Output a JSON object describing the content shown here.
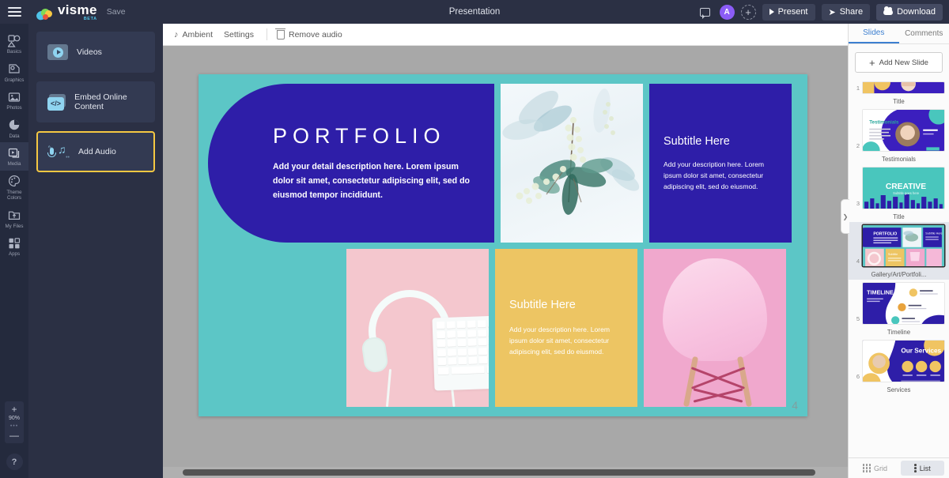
{
  "header": {
    "menu_icon": "hamburger-icon",
    "logo_text": "visme",
    "logo_beta": "BETA",
    "save_label": "Save",
    "doc_title": "Presentation",
    "chat_icon": "chat-icon",
    "avatar_initial": "A",
    "add_user_icon": "add-user-icon",
    "present_label": "Present",
    "share_label": "Share",
    "download_label": "Download"
  },
  "rail": {
    "items": [
      {
        "label": "Basics",
        "icon": "basics-icon",
        "active": false
      },
      {
        "label": "Graphics",
        "icon": "graphics-icon",
        "active": false
      },
      {
        "label": "Photos",
        "icon": "photos-icon",
        "active": false
      },
      {
        "label": "Data",
        "icon": "data-icon",
        "active": false
      },
      {
        "label": "Media",
        "icon": "media-icon",
        "active": true
      },
      {
        "label": "Theme Colors",
        "icon": "theme-colors-icon",
        "active": false
      },
      {
        "label": "My Files",
        "icon": "my-files-icon",
        "active": false
      },
      {
        "label": "Apps",
        "icon": "apps-icon",
        "active": false
      }
    ],
    "zoom_in": "+",
    "zoom_value": "90%",
    "zoom_out": "—",
    "help_label": "?"
  },
  "media_panel": {
    "cards": [
      {
        "label": "Videos",
        "icon": "video-icon",
        "selected": false
      },
      {
        "label": "Embed Online Content",
        "icon": "embed-code-icon",
        "selected": false
      },
      {
        "label": "Add Audio",
        "icon": "audio-icon",
        "selected": true
      }
    ]
  },
  "toolbar": {
    "audio_track": "Ambient",
    "settings_label": "Settings",
    "remove_audio_label": "Remove audio",
    "note_icon": "music-note-icon",
    "trash_icon": "trash-icon"
  },
  "slide": {
    "number": "4",
    "background_color": "#5cc6c6",
    "blocks": {
      "portfolio": {
        "title": "PORTFOLIO",
        "body": "Add your detail description here. Lorem ipsum dolor sit amet, consectetur adipiscing elit, sed do eiusmod tempor incididunt.",
        "color": "#2e1ea8"
      },
      "botanical": {
        "alt": "watercolor botanical leaves illustration"
      },
      "subtitle_right": {
        "title": "Subtitle Here",
        "body": "Add your description here. Lorem ipsum dolor sit amet, consectetur adipiscing elit, sed do eiusmod.",
        "color": "#2e1ea8"
      },
      "headphones": {
        "alt": "white headphones and keyboard on pink background"
      },
      "subtitle_yellow": {
        "title": "Subtitle Here",
        "body": "Add your description here. Lorem ipsum dolor sit amet, consectetur adipiscing elit, sed do eiusmod.",
        "color": "#edc563"
      },
      "chair": {
        "alt": "pink chair on pink background"
      }
    }
  },
  "right_panel": {
    "tabs": [
      {
        "label": "Slides",
        "active": true
      },
      {
        "label": "Comments",
        "active": false
      }
    ],
    "add_new_slide": "Add New Slide",
    "collapse_icon": "chevron-right-icon",
    "slides": [
      {
        "num": "1",
        "caption": "Title",
        "active": false,
        "theme": "title"
      },
      {
        "num": "2",
        "caption": "Testimonials",
        "active": false,
        "theme": "testimonials"
      },
      {
        "num": "3",
        "caption": "Title",
        "active": false,
        "theme": "creative"
      },
      {
        "num": "4",
        "caption": "Gallery/Art/Portfoli...",
        "active": true,
        "theme": "gallery"
      },
      {
        "num": "5",
        "caption": "Timeline",
        "active": false,
        "theme": "timeline"
      },
      {
        "num": "6",
        "caption": "Services",
        "active": false,
        "theme": "services"
      }
    ],
    "view_modes": [
      {
        "label": "Grid",
        "active": false,
        "icon": "grid-icon"
      },
      {
        "label": "List",
        "active": true,
        "icon": "list-icon"
      }
    ]
  },
  "thumbnails": {
    "slide3_title": "CREATIVE",
    "slide3_sub": "Subtitle goes here",
    "slide4_title": "PORTFOLIO",
    "slide5_title": "TIMELINE",
    "slide6_title": "Our Services",
    "slide2_title": "Testimonials"
  }
}
